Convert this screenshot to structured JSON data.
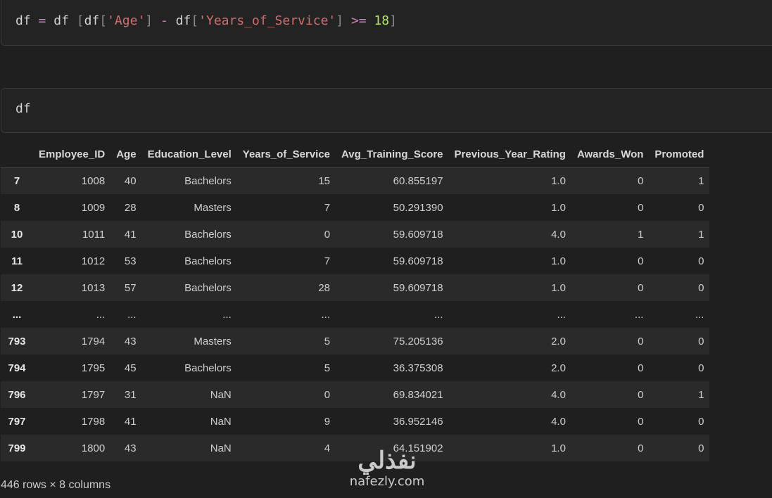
{
  "cells": [
    {
      "code_tokens": [
        {
          "t": "df ",
          "c": ""
        },
        {
          "t": "=",
          "c": "op"
        },
        {
          "t": " df ",
          "c": ""
        },
        {
          "t": "[",
          "c": "br"
        },
        {
          "t": "df",
          "c": ""
        },
        {
          "t": "[",
          "c": "br"
        },
        {
          "t": "'Age'",
          "c": "str"
        },
        {
          "t": "]",
          "c": "br"
        },
        {
          "t": " ",
          "c": ""
        },
        {
          "t": "-",
          "c": "op"
        },
        {
          "t": " df",
          "c": ""
        },
        {
          "t": "[",
          "c": "br"
        },
        {
          "t": "'Years_of_Service'",
          "c": "str"
        },
        {
          "t": "]",
          "c": "br"
        },
        {
          "t": " ",
          "c": ""
        },
        {
          "t": ">=",
          "c": "op"
        },
        {
          "t": " ",
          "c": ""
        },
        {
          "t": "18",
          "c": "num"
        },
        {
          "t": "]",
          "c": "br"
        }
      ]
    },
    {
      "code": "df"
    }
  ],
  "table": {
    "columns": [
      "",
      "Employee_ID",
      "Age",
      "Education_Level",
      "Years_of_Service",
      "Avg_Training_Score",
      "Previous_Year_Rating",
      "Awards_Won",
      "Promoted"
    ],
    "rows": [
      [
        "7",
        "1008",
        "40",
        "Bachelors",
        "15",
        "60.855197",
        "1.0",
        "0",
        "1"
      ],
      [
        "8",
        "1009",
        "28",
        "Masters",
        "7",
        "50.291390",
        "1.0",
        "0",
        "0"
      ],
      [
        "10",
        "1011",
        "41",
        "Bachelors",
        "0",
        "59.609718",
        "4.0",
        "1",
        "1"
      ],
      [
        "11",
        "1012",
        "53",
        "Bachelors",
        "7",
        "59.609718",
        "1.0",
        "0",
        "0"
      ],
      [
        "12",
        "1013",
        "57",
        "Bachelors",
        "28",
        "59.609718",
        "1.0",
        "0",
        "0"
      ],
      [
        "...",
        "...",
        "...",
        "...",
        "...",
        "...",
        "...",
        "...",
        "..."
      ],
      [
        "793",
        "1794",
        "43",
        "Masters",
        "5",
        "75.205136",
        "2.0",
        "0",
        "0"
      ],
      [
        "794",
        "1795",
        "45",
        "Bachelors",
        "5",
        "36.375308",
        "2.0",
        "0",
        "0"
      ],
      [
        "796",
        "1797",
        "31",
        "NaN",
        "0",
        "69.834021",
        "4.0",
        "0",
        "1"
      ],
      [
        "797",
        "1798",
        "41",
        "NaN",
        "9",
        "36.952146",
        "4.0",
        "0",
        "0"
      ],
      [
        "799",
        "1800",
        "43",
        "NaN",
        "4",
        "64.151902",
        "1.0",
        "0",
        "0"
      ]
    ]
  },
  "shape_text": "446 rows × 8 columns",
  "watermark": {
    "logo_text": "نفذلي",
    "url": "nafezly.com"
  },
  "colors": {
    "background": "#1f1f1f",
    "cell_bg": "#232323",
    "keyword": "#c586c0",
    "string": "#ce6f6f",
    "number": "#b5e46c"
  }
}
